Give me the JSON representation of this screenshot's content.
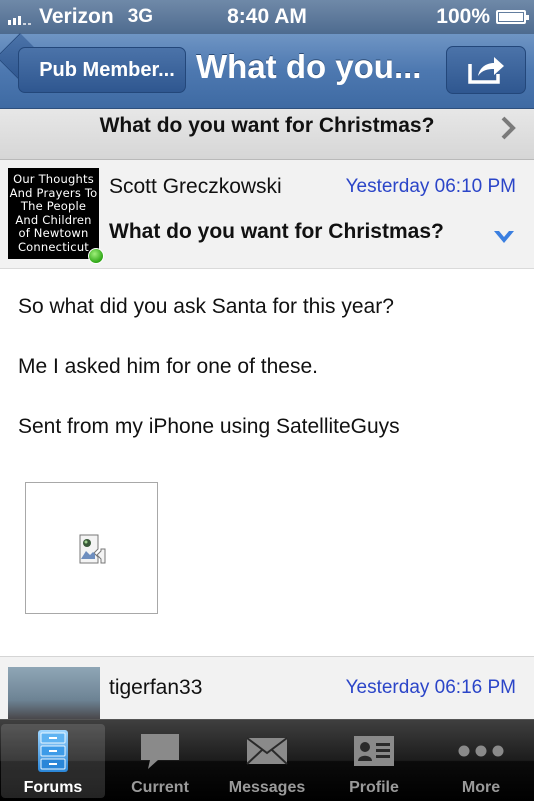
{
  "status_bar": {
    "carrier": "Verizon",
    "network": "3G",
    "time": "8:40 AM",
    "battery": "100%"
  },
  "nav": {
    "back_label": "Pub Member...",
    "title": "What do you..."
  },
  "thread": {
    "title": "What do you want for Christmas?"
  },
  "post": {
    "avatar_text": "Our Thoughts And Prayers To The People And Children of Newtown Connecticut",
    "author": "Scott Greczkowski",
    "timestamp": "Yesterday 06:10 PM",
    "title": "What do you want for Christmas?",
    "body": [
      "So what did you ask Santa for this year?",
      "Me I asked him for one of these.",
      "Sent from my iPhone using SatelliteGuys"
    ]
  },
  "next_post": {
    "author": "tigerfan33",
    "timestamp": "Yesterday 06:16 PM"
  },
  "tabs": [
    {
      "label": "Forums",
      "icon": "forums-icon",
      "active": true
    },
    {
      "label": "Current",
      "icon": "speech-bubble-icon",
      "active": false
    },
    {
      "label": "Messages",
      "icon": "envelope-icon",
      "active": false
    },
    {
      "label": "Profile",
      "icon": "profile-card-icon",
      "active": false
    },
    {
      "label": "More",
      "icon": "more-dots-icon",
      "active": false
    }
  ],
  "colors": {
    "nav_blue": "#4d78b0",
    "timestamp_blue": "#2b45c8",
    "online_green": "#2fa617"
  }
}
